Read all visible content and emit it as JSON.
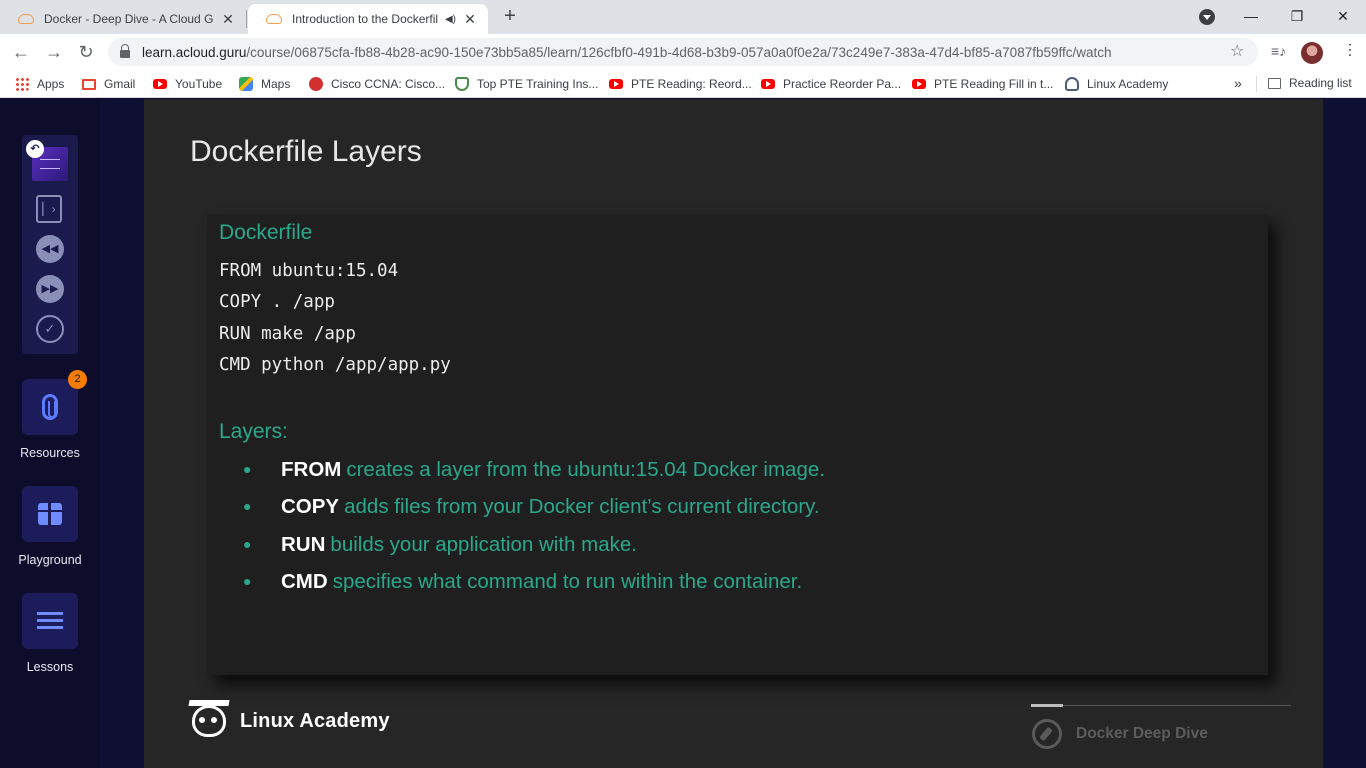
{
  "browser": {
    "tabs": [
      {
        "title": "Docker - Deep Dive - A Cloud Gu",
        "active": false
      },
      {
        "title": "Introduction to the Dockerfil",
        "active": true,
        "audio": true
      }
    ],
    "new_tab_icon": "plus-icon",
    "window_controls": {
      "minimize": "—",
      "restore": "❐",
      "close": "✕"
    },
    "url_host": "learn.acloud.guru",
    "url_path": "/course/06875cfa-fb88-4b28-ac90-150e73bb5a85/learn/126cfbf0-491b-4d68-b3b9-057a0a0f0e2a/73c249e7-383a-47d4-bf85-a7087fb59ffc/watch",
    "bookmarks": [
      {
        "label": "Apps",
        "icon": "apps"
      },
      {
        "label": "Gmail",
        "icon": "gmail"
      },
      {
        "label": "YouTube",
        "icon": "yt"
      },
      {
        "label": "Maps",
        "icon": "maps"
      },
      {
        "label": "Cisco CCNA: Cisco...",
        "icon": "cisco"
      },
      {
        "label": "Top PTE Training Ins...",
        "icon": "pte"
      },
      {
        "label": "PTE Reading: Reord...",
        "icon": "yt"
      },
      {
        "label": "Practice Reorder Pa...",
        "icon": "yt"
      },
      {
        "label": "PTE Reading Fill in t...",
        "icon": "yt"
      },
      {
        "label": "Linux Academy",
        "icon": "la"
      }
    ],
    "bookmarks_more": "»",
    "reading_list": "Reading list"
  },
  "sidebar": {
    "resources_label": "Resources",
    "resources_badge": "2",
    "playground_label": "Playground",
    "lessons_label": "Lessons"
  },
  "slide": {
    "title": "Dockerfile Layers",
    "code_heading": "Dockerfile",
    "code_lines": [
      "FROM ubuntu:15.04",
      "COPY . /app",
      "RUN make /app",
      "CMD python /app/app.py"
    ],
    "layers_heading": "Layers:",
    "bullets": [
      {
        "keyword": "FROM",
        "text": "creates a layer from the ubuntu:15.04 Docker image."
      },
      {
        "keyword": "COPY",
        "text": "adds files from your Docker client’s current directory."
      },
      {
        "keyword": "RUN",
        "text": "builds your application with make."
      },
      {
        "keyword": "CMD",
        "text": "specifies what command to run within the container."
      }
    ],
    "footer_brand": "Linux Academy",
    "footer_course": "Docker Deep Dive"
  },
  "colors": {
    "accent_green": "#2aa88a",
    "sidebar_blue": "#5b7cff",
    "badge_orange": "#f57c00"
  }
}
